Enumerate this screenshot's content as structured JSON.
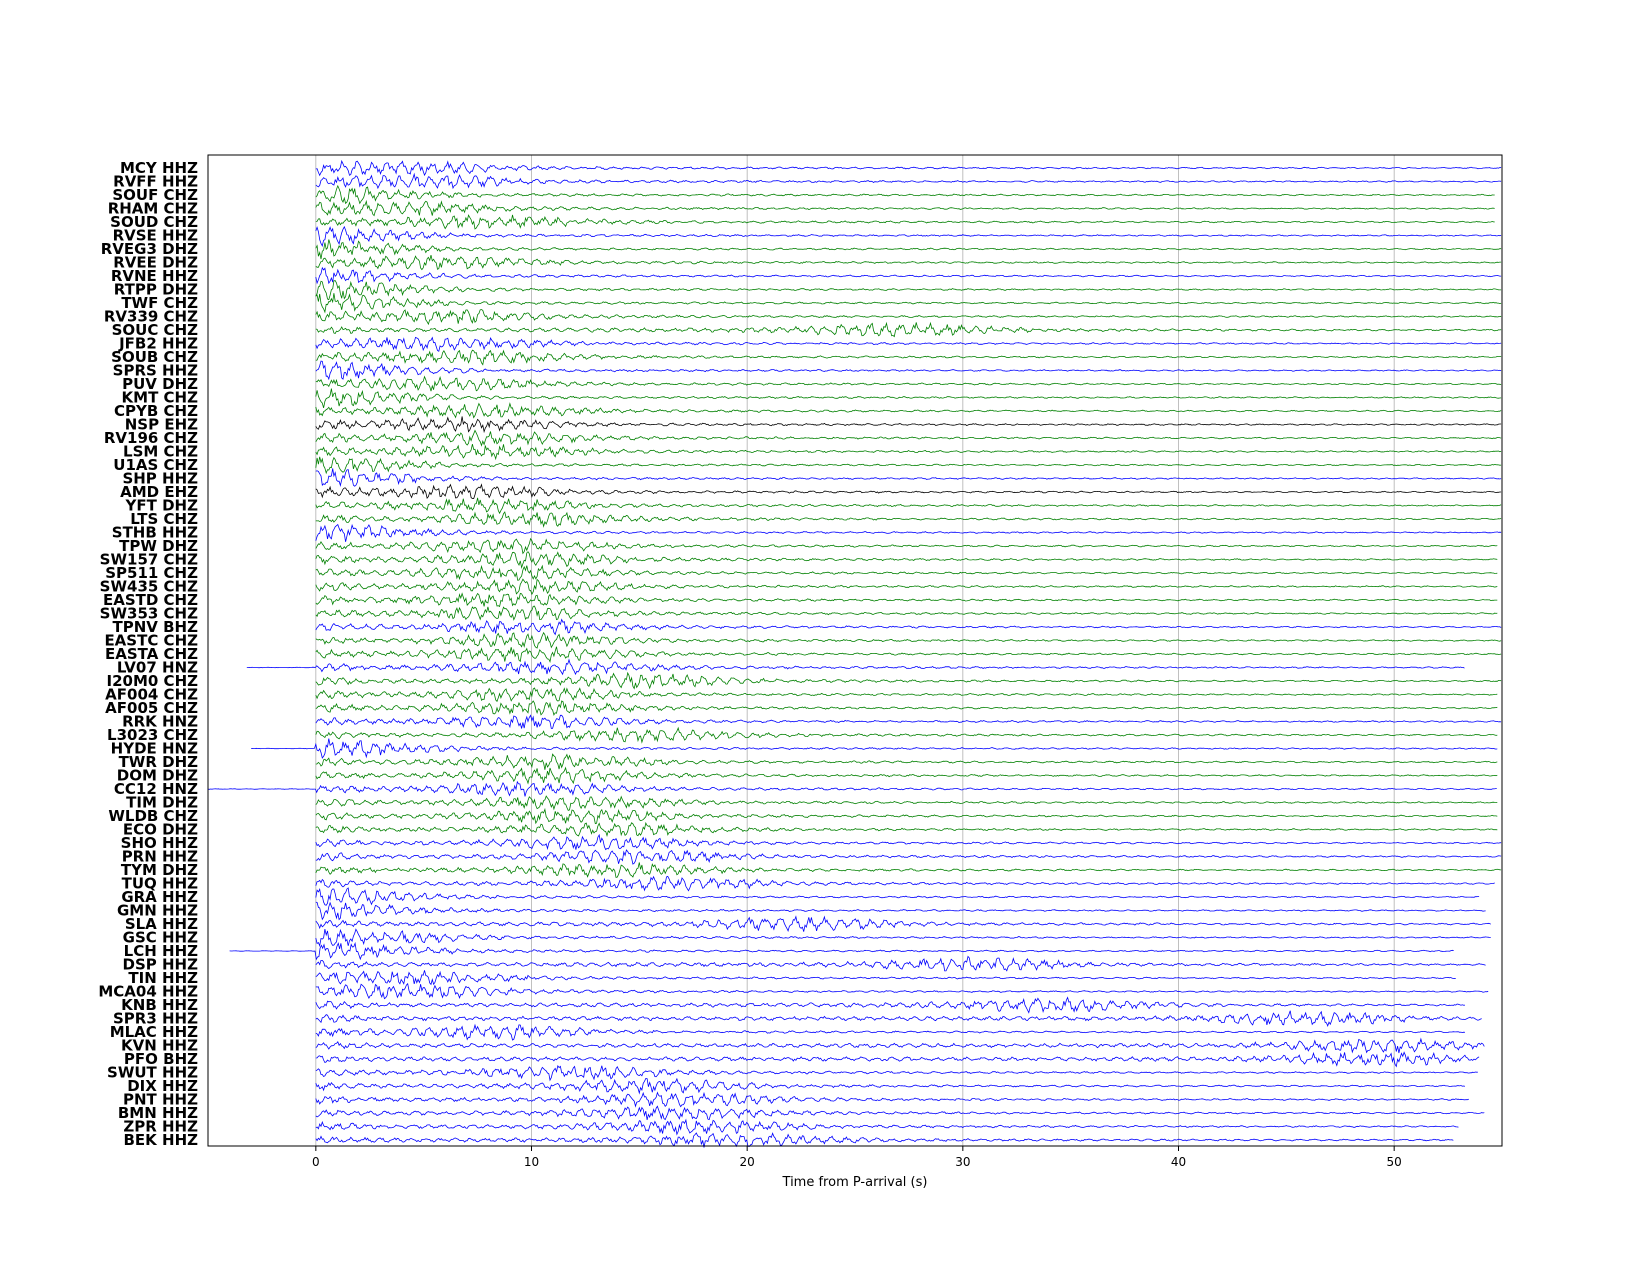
{
  "chart_data": {
    "type": "line",
    "title": "",
    "xlabel": "Time from P-arrival (s)",
    "ylabel": "",
    "xlim": [
      -5,
      55
    ],
    "xticks": [
      0,
      10,
      20,
      30,
      40,
      50
    ],
    "xtick_labels": [
      "0",
      "10",
      "20",
      "30",
      "40",
      "50"
    ],
    "grid": true,
    "colors": {
      "blue": "#0000ff",
      "green": "#008000",
      "black": "#000000",
      "grid": "#b0b0b0"
    },
    "series": [
      {
        "name": "MCY HHZ",
        "color": "blue",
        "start": 0,
        "end": 55,
        "peak": 4
      },
      {
        "name": "RVFF HHZ",
        "color": "blue",
        "start": 0,
        "end": 55,
        "peak": 5
      },
      {
        "name": "SOUF CHZ",
        "color": "green",
        "start": 0,
        "end": 54.7,
        "peak": 1
      },
      {
        "name": "RHAM CHZ",
        "color": "green",
        "start": 0,
        "end": 54.7,
        "peak": 4
      },
      {
        "name": "SOUD CHZ",
        "color": "green",
        "start": 0,
        "end": 54.7,
        "peak": 8
      },
      {
        "name": "RVSE HHZ",
        "color": "blue",
        "start": 0,
        "end": 55,
        "peak": 0.5
      },
      {
        "name": "RVEG3 DHZ",
        "color": "green",
        "start": 0,
        "end": 55,
        "peak": 0.5
      },
      {
        "name": "RVEE DHZ",
        "color": "green",
        "start": 0,
        "end": 55,
        "peak": 6
      },
      {
        "name": "RVNE HHZ",
        "color": "blue",
        "start": 0,
        "end": 55,
        "peak": 0.5
      },
      {
        "name": "RTPP DHZ",
        "color": "green",
        "start": 0,
        "end": 55,
        "peak": 1
      },
      {
        "name": "TWF CHZ",
        "color": "green",
        "start": 0,
        "end": 55,
        "peak": 1
      },
      {
        "name": "RV339 CHZ",
        "color": "green",
        "start": 0,
        "end": 55,
        "peak": 6
      },
      {
        "name": "SOUC CHZ",
        "color": "green",
        "start": 0,
        "end": 55,
        "peak": 27
      },
      {
        "name": "JFB2 HHZ",
        "color": "blue",
        "start": 0,
        "end": 55,
        "peak": 6
      },
      {
        "name": "SOUB CHZ",
        "color": "green",
        "start": 0,
        "end": 55,
        "peak": 7
      },
      {
        "name": "SPRS HHZ",
        "color": "blue",
        "start": 0,
        "end": 55,
        "peak": 1
      },
      {
        "name": "PUV DHZ",
        "color": "green",
        "start": 0,
        "end": 55,
        "peak": 6
      },
      {
        "name": "KMT CHZ",
        "color": "green",
        "start": 0,
        "end": 55,
        "peak": 1
      },
      {
        "name": "CPYB CHZ",
        "color": "green",
        "start": 0,
        "end": 55,
        "peak": 8
      },
      {
        "name": "NSP EHZ",
        "color": "black",
        "start": 0,
        "end": 55,
        "peak": 7
      },
      {
        "name": "RV196 CHZ",
        "color": "green",
        "start": 0,
        "end": 55,
        "peak": 8
      },
      {
        "name": "LSM CHZ",
        "color": "green",
        "start": 0,
        "end": 55,
        "peak": 8
      },
      {
        "name": "U1AS CHZ",
        "color": "green",
        "start": 0,
        "end": 55,
        "peak": 1
      },
      {
        "name": "SHP HHZ",
        "color": "blue",
        "start": 0,
        "end": 55,
        "peak": 1
      },
      {
        "name": "AMD EHZ",
        "color": "black",
        "start": 0,
        "end": 55,
        "peak": 7
      },
      {
        "name": "YFT DHZ",
        "color": "green",
        "start": 0,
        "end": 55,
        "peak": 8
      },
      {
        "name": "LTS CHZ",
        "color": "green",
        "start": 0,
        "end": 55,
        "peak": 10
      },
      {
        "name": "STHB HHZ",
        "color": "blue",
        "start": 0,
        "end": 55,
        "peak": 1
      },
      {
        "name": "TPW DHZ",
        "color": "green",
        "start": 0,
        "end": 54.8,
        "peak": 9
      },
      {
        "name": "SW157 CHZ",
        "color": "green",
        "start": 0,
        "end": 54.8,
        "peak": 10
      },
      {
        "name": "SP511 CHZ",
        "color": "green",
        "start": 0,
        "end": 54.8,
        "peak": 9
      },
      {
        "name": "SW435 CHZ",
        "color": "green",
        "start": 0,
        "end": 54.8,
        "peak": 10
      },
      {
        "name": "EASTD CHZ",
        "color": "green",
        "start": 0,
        "end": 54.8,
        "peak": 9
      },
      {
        "name": "SW353 CHZ",
        "color": "green",
        "start": 0,
        "end": 54.8,
        "peak": 9
      },
      {
        "name": "TPNV BHZ",
        "color": "blue",
        "start": 0,
        "end": 55,
        "peak": 10
      },
      {
        "name": "EASTC CHZ",
        "color": "green",
        "start": 0,
        "end": 55,
        "peak": 10
      },
      {
        "name": "EASTA CHZ",
        "color": "green",
        "start": 0,
        "end": 55,
        "peak": 10
      },
      {
        "name": "LV07 HNZ",
        "color": "blue",
        "start": -3.2,
        "end": 53.3,
        "peak": 11
      },
      {
        "name": "I20M0 CHZ",
        "color": "green",
        "start": 0,
        "end": 55,
        "peak": 15
      },
      {
        "name": "AF004 CHZ",
        "color": "green",
        "start": 0,
        "end": 54.8,
        "peak": 10
      },
      {
        "name": "AF005 CHZ",
        "color": "green",
        "start": 0,
        "end": 54.8,
        "peak": 10
      },
      {
        "name": "RRK HNZ",
        "color": "blue",
        "start": 0,
        "end": 55,
        "peak": 10
      },
      {
        "name": "L3023 CHZ",
        "color": "green",
        "start": 0,
        "end": 54.8,
        "peak": 15
      },
      {
        "name": "HYDE HNZ",
        "color": "blue",
        "start": -3,
        "end": 54.8,
        "peak": 1.5
      },
      {
        "name": "TWR DHZ",
        "color": "green",
        "start": 0,
        "end": 54.8,
        "peak": 11
      },
      {
        "name": "DOM DHZ",
        "color": "green",
        "start": 0,
        "end": 54.8,
        "peak": 11
      },
      {
        "name": "CC12 HNZ",
        "color": "blue",
        "start": -5,
        "end": 54.8,
        "peak": 10
      },
      {
        "name": "TIM DHZ",
        "color": "green",
        "start": 0,
        "end": 54.8,
        "peak": 12
      },
      {
        "name": "WLDB CHZ",
        "color": "green",
        "start": 0,
        "end": 54.8,
        "peak": 12
      },
      {
        "name": "ECO DHZ",
        "color": "green",
        "start": 0,
        "end": 54.8,
        "peak": 13.5
      },
      {
        "name": "SHO HHZ",
        "color": "blue",
        "start": 0,
        "end": 55,
        "peak": 13
      },
      {
        "name": "PRN HHZ",
        "color": "blue",
        "start": 0,
        "end": 55,
        "peak": 15
      },
      {
        "name": "TYM DHZ",
        "color": "green",
        "start": 0,
        "end": 55,
        "peak": 14
      },
      {
        "name": "TUQ HHZ",
        "color": "blue",
        "start": 0,
        "end": 54.7,
        "peak": 16.5
      },
      {
        "name": "GRA HHZ",
        "color": "blue",
        "start": 0,
        "end": 54,
        "peak": 0.8
      },
      {
        "name": "GMN HHZ",
        "color": "blue",
        "start": 0,
        "end": 54.3,
        "peak": 0.8
      },
      {
        "name": "SLA HHZ",
        "color": "blue",
        "start": 0,
        "end": 54.5,
        "peak": 22.5
      },
      {
        "name": "GSC HHZ",
        "color": "blue",
        "start": 0,
        "end": 54.5,
        "peak": 2.5
      },
      {
        "name": "LCH HHZ",
        "color": "blue",
        "start": -4,
        "end": 52.8,
        "peak": 1
      },
      {
        "name": "DSP HHZ",
        "color": "blue",
        "start": 0,
        "end": 54.3,
        "peak": 30.5
      },
      {
        "name": "TIN HHZ",
        "color": "blue",
        "start": 0,
        "end": 52.9,
        "peak": 4.5
      },
      {
        "name": "MCA04 HHZ",
        "color": "blue",
        "start": 0,
        "end": 54.4,
        "peak": 4.5
      },
      {
        "name": "KNB HHZ",
        "color": "blue",
        "start": 0,
        "end": 53.3,
        "peak": 34
      },
      {
        "name": "SPR3 HHZ",
        "color": "blue",
        "start": 0,
        "end": 54.1,
        "peak": 46
      },
      {
        "name": "MLAC HHZ",
        "color": "blue",
        "start": 0,
        "end": 53.3,
        "peak": 8.5
      },
      {
        "name": "KVN HHZ",
        "color": "blue",
        "start": 0,
        "end": 54.2,
        "peak": 49
      },
      {
        "name": "PFO BHZ",
        "color": "blue",
        "start": 0,
        "end": 54,
        "peak": 49
      },
      {
        "name": "SWUT HHZ",
        "color": "blue",
        "start": 0,
        "end": 53.9,
        "peak": 12
      },
      {
        "name": "DIX HHZ",
        "color": "blue",
        "start": 0,
        "end": 53.3,
        "peak": 15.5
      },
      {
        "name": "PNT HHZ",
        "color": "blue",
        "start": 0,
        "end": 53.5,
        "peak": 17
      },
      {
        "name": "BMN HHZ",
        "color": "blue",
        "start": 0,
        "end": 54.2,
        "peak": 16.5
      },
      {
        "name": "ZPR HHZ",
        "color": "blue",
        "start": 0,
        "end": 53,
        "peak": 17.5
      },
      {
        "name": "BEK HHZ",
        "color": "blue",
        "start": 0,
        "end": 52.8,
        "peak": 19.5
      }
    ]
  }
}
